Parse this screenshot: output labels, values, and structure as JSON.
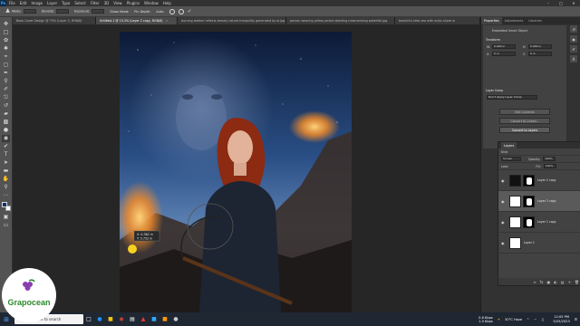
{
  "menubar": {
    "app_icon": "Ps",
    "items": [
      "File",
      "Edit",
      "Image",
      "Layer",
      "Type",
      "Select",
      "Filter",
      "3D",
      "View",
      "Plugins",
      "Window",
      "Help"
    ]
  },
  "options": {
    "mode_label": "Mode:",
    "mode_value": "Normal",
    "density_label": "Density:",
    "density_value": "Normal",
    "exposure_label": "Exposure:",
    "exposure_value": "Low",
    "show_label": "Show Head:",
    "pin_label": "Pin Depth:",
    "auto_label": "Auto"
  },
  "tabs": [
    "Book Cover Design @ 75% (Layer 5, RGB/8)",
    "Untitled-1 @ 15.2% (Layer 2 copy, RGB/8)",
    "burning leather reflects beauty nature tranquility generated by ai.jpg",
    "person wearing yellow jacket standing mesmerizing waterfall.jpg",
    "beautiful view sea with rocks shore w"
  ],
  "panel_tabs": [
    "Properties",
    "Adjustments",
    "Libraries"
  ],
  "properties": {
    "header": "Embedded Smart Object",
    "transform_label": "Transform",
    "w_label": "W:",
    "w_value": "0.000 in",
    "h_label": "H:",
    "h_value": "0.000 in",
    "x_label": "X:",
    "x_value": "0 in",
    "y_label": "Y:",
    "y_value": "0 in",
    "comps_label": "Layer Comp",
    "comps_value": "Don't Apply Layer Comp",
    "btn_edit": "Edit Contents",
    "btn_convert_linked": "Convert to Linked...",
    "btn_convert_layers": "Convert to Layers"
  },
  "layers": {
    "panel_title": "Layers",
    "kind_label": "Kind",
    "blend_value": "Screen",
    "opacity_label": "Opacity:",
    "opacity_value": "100%",
    "lock_label": "Lock:",
    "fill_label": "Fill:",
    "fill_value": "100%",
    "items": [
      {
        "name": "Layer 2 copy",
        "selected": false
      },
      {
        "name": "Layer 2 copy",
        "selected": true
      },
      {
        "name": "Layer 1 copy",
        "selected": false
      },
      {
        "name": "Layer 1",
        "selected": false
      }
    ]
  },
  "canvas_readout": {
    "line1": "X: 0.362 in",
    "line2": "Y: 5.752 in"
  },
  "taskbar": {
    "search_placeholder": "Type here to search",
    "weather": "30°C Haze",
    "net_up": "0.6 Kbps",
    "net_down": "1.0 Kbps",
    "time": "12:05 PM",
    "date": "5/25/2023"
  },
  "watermark": {
    "text": "Grapocean"
  },
  "colors": {
    "accent": "#31a8ff",
    "foreground_swatch": "#0c2f6b",
    "background_swatch": "#ffffff",
    "logo_green": "#2b8a2b"
  }
}
